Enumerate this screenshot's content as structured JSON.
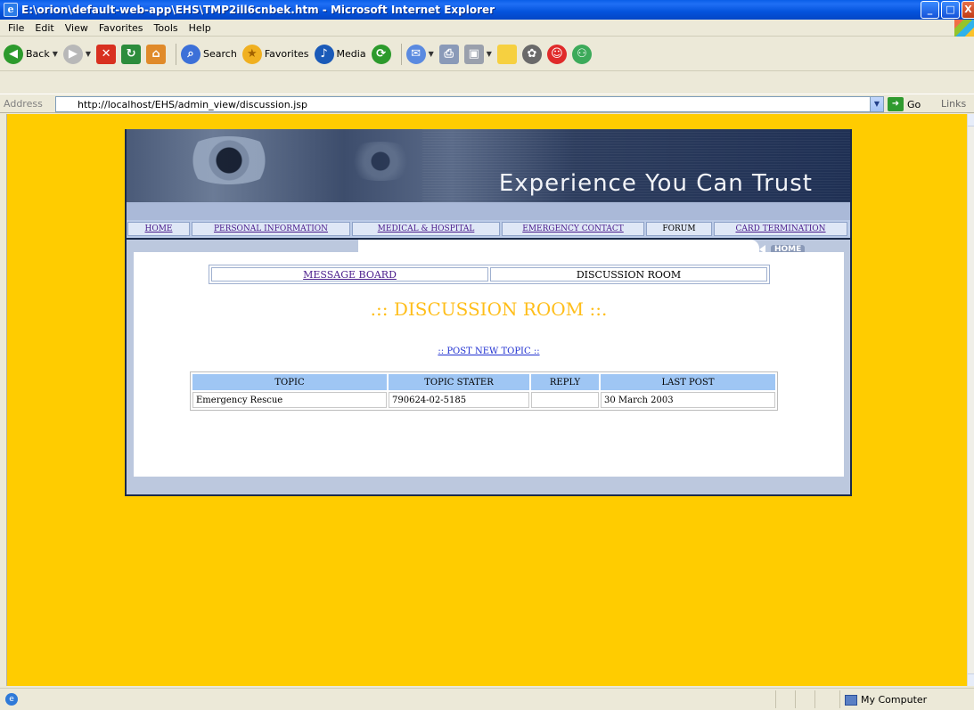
{
  "window": {
    "title": "E:\\orion\\default-web-app\\EHS\\TMP2ill6cnbek.htm - Microsoft Internet Explorer",
    "app_icon": "ie-icon",
    "minimize": "_",
    "maximize": "□",
    "close": "X"
  },
  "menu": [
    "File",
    "Edit",
    "View",
    "Favorites",
    "Tools",
    "Help"
  ],
  "toolbar": {
    "back": "Back",
    "search": "Search",
    "favorites": "Favorites",
    "media": "Media"
  },
  "address": {
    "label": "Address",
    "url": "http://localhost/EHS/admin_view/discussion.jsp",
    "go": "Go",
    "links": "Links"
  },
  "banner": {
    "tagline": "Experience You Can Trust"
  },
  "nav": {
    "items": [
      {
        "label": "HOME",
        "active": false
      },
      {
        "label": "PERSONAL INFORMATION",
        "active": false
      },
      {
        "label": "MEDICAL & HOSPITAL",
        "active": false
      },
      {
        "label": "EMERGENCY CONTACT",
        "active": false
      },
      {
        "label": "FORUM",
        "active": true
      },
      {
        "label": "CARD TERMINATION",
        "active": false
      }
    ],
    "home_button": "HOME"
  },
  "subtabs": {
    "message_board": "MESSAGE BOARD",
    "discussion_room": "DISCUSSION ROOM"
  },
  "page": {
    "title": ".:: DISCUSSION ROOM ::.",
    "post_new_topic": ":: POST NEW TOPIC ::"
  },
  "table": {
    "headers": [
      "TOPIC",
      "TOPIC STATER",
      "REPLY",
      "LAST POST"
    ],
    "rows": [
      [
        "Emergency Rescue",
        "790624-02-5185",
        "",
        "30 March 2003"
      ]
    ]
  },
  "status": {
    "zone": "My Computer"
  },
  "colors": {
    "page_background": "#ffcc00",
    "title_color": "#ffbe1a",
    "table_header": "#9fc6f4",
    "link": "#2030d0",
    "visited_link": "#4a1c8c"
  }
}
